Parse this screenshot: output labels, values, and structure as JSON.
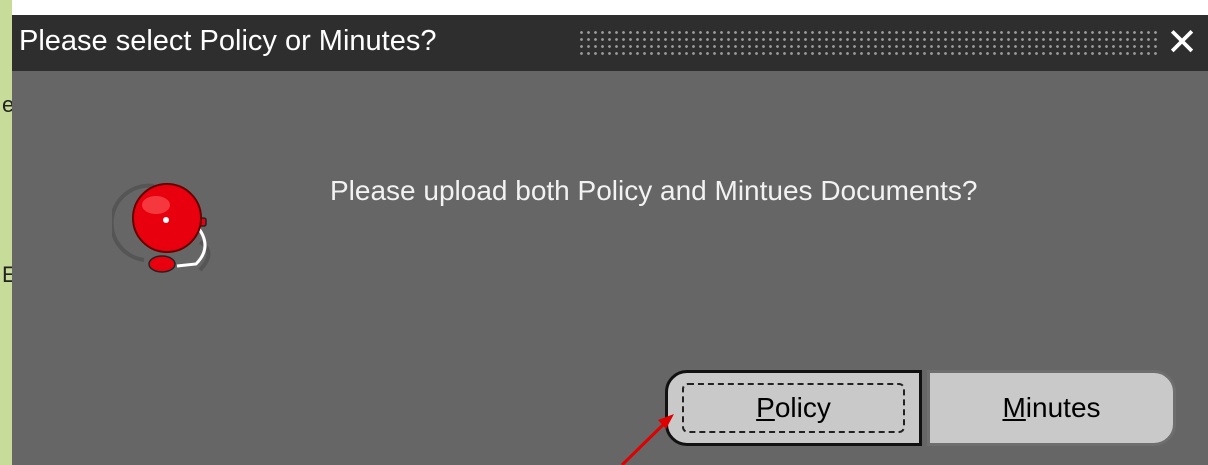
{
  "dialog": {
    "title": "Please select Policy or Minutes?",
    "message": "Please upload both Policy and Mintues Documents?",
    "close_symbol": "✕",
    "icon": "alarm-bell-icon"
  },
  "buttons": {
    "policy": {
      "label": "Policy",
      "mnemonic": "P",
      "rest": "olicy"
    },
    "minutes": {
      "label": "Minutes",
      "mnemonic": "M",
      "rest": "inutes"
    }
  },
  "background": {
    "strip_glyph_top": "e",
    "strip_glyph_bottom": "E"
  },
  "colors": {
    "titlebar": "#2e2e2e",
    "dialog_body": "#666666",
    "button_face": "#c9c9c9",
    "bell_red": "#e8000e",
    "annotation_arrow": "#e00000"
  }
}
